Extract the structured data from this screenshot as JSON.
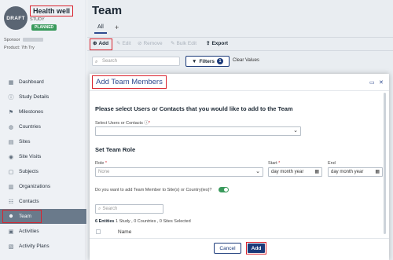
{
  "study": {
    "badge": "DRAFT",
    "title": "Health well",
    "subtitle": "STUDY",
    "status": "PLANNED",
    "sponsor_label": "Sponsor",
    "product_label": "Product: 7th Try"
  },
  "sidebar": {
    "items": [
      {
        "label": "Dashboard",
        "icon": "dashboard-icon"
      },
      {
        "label": "Study Details",
        "icon": "info-icon"
      },
      {
        "label": "Milestones",
        "icon": "flag-icon"
      },
      {
        "label": "Countries",
        "icon": "globe-icon"
      },
      {
        "label": "Sites",
        "icon": "building-icon"
      },
      {
        "label": "Site Visits",
        "icon": "visit-icon"
      },
      {
        "label": "Subjects",
        "icon": "document-icon"
      },
      {
        "label": "Organizations",
        "icon": "organization-icon"
      },
      {
        "label": "Contacts",
        "icon": "contacts-icon"
      },
      {
        "label": "Team",
        "icon": "team-icon",
        "active": true
      },
      {
        "label": "Activities",
        "icon": "activities-icon"
      },
      {
        "label": "Activity Plans",
        "icon": "plans-icon"
      }
    ]
  },
  "header": {
    "title": "Team",
    "tab_all": "All",
    "tab_add": "+"
  },
  "toolbar": {
    "add": "Add",
    "edit": "Edit",
    "remove": "Remove",
    "bulk_edit": "Bulk Edit",
    "export": "Export"
  },
  "filter_bar": {
    "search_placeholder": "Search",
    "filters_label": "Filters",
    "filters_count": "1",
    "clear_values": "Clear Values"
  },
  "modal": {
    "title": "Add Team Members",
    "prompt": "Please select Users or Contacts that you would like to add to the Team",
    "select_label": "Select Users or Contacts",
    "set_role_heading": "Set Team Role",
    "role_label": "Role",
    "role_placeholder": "None",
    "start_label": "Start",
    "start_placeholder": "day month year",
    "end_label": "End",
    "end_placeholder": "day month year",
    "add_to_site_question": "Do you want to add Team Member to Site(s) or Country(ies)?",
    "search_placeholder": "Search",
    "entities_count": "6 Entities",
    "entities_detail": "1 Study , 0 Countries , 0 Sites Selected",
    "name_column": "Name",
    "cancel": "Cancel",
    "add": "Add"
  },
  "colors": {
    "accent": "#1b3a7a",
    "highlight": "#d9232e",
    "toggle_on": "#3a9a5c"
  }
}
